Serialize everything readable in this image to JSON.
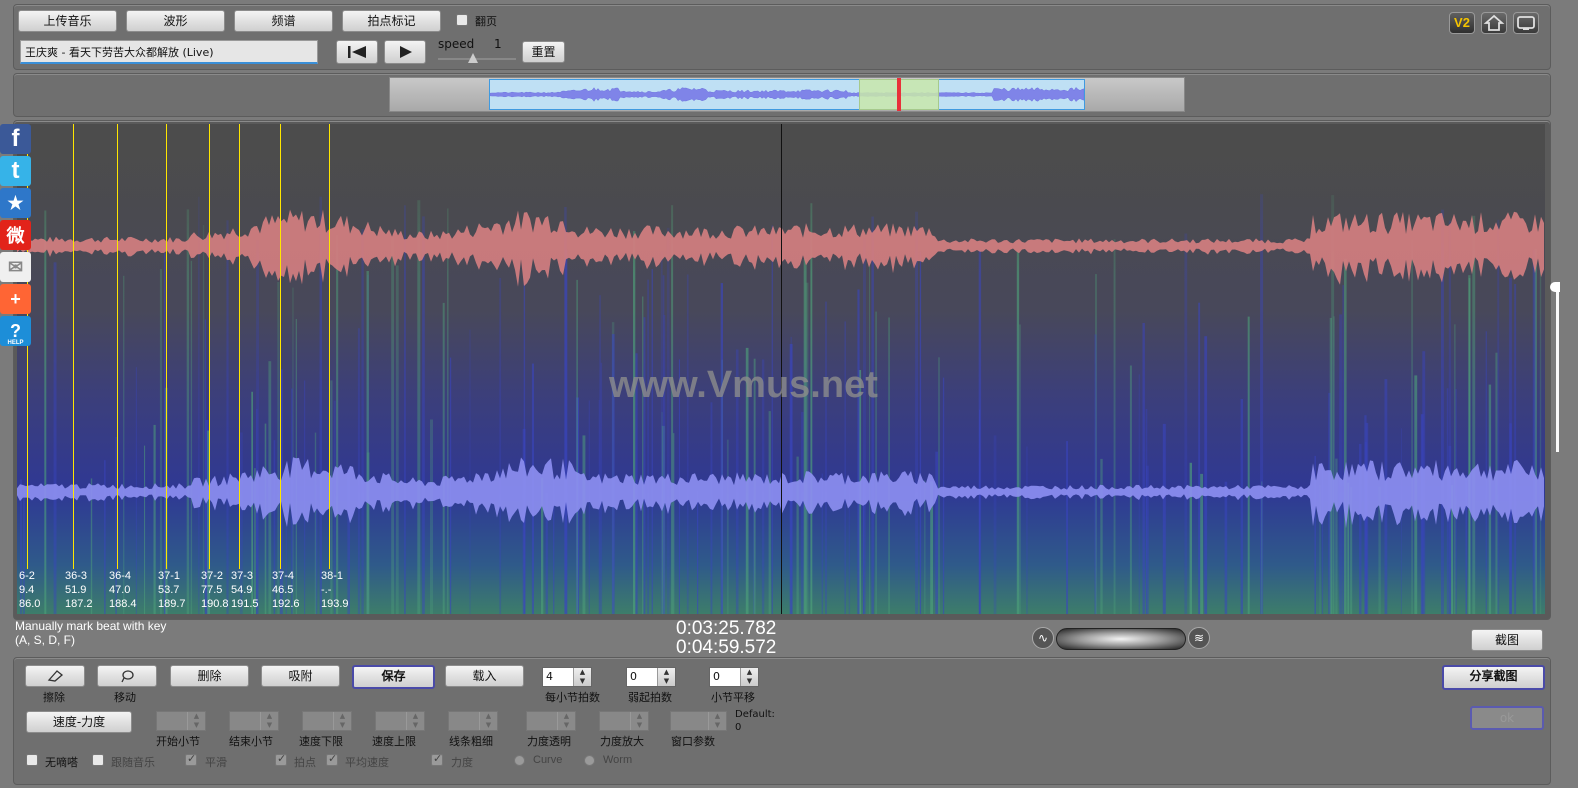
{
  "toolbar": {
    "upload_label": "上传音乐",
    "waveform_label": "波形",
    "spectrum_label": "频谱",
    "beat_mark_label": "拍点标记",
    "page_turn_label": "翻页",
    "song_title": "王庆爽 - 看天下劳苦大众都解放 (Live)",
    "speed_label": "speed",
    "speed_value": "1",
    "reset_label": "重置",
    "speed_slider_level": 0.45
  },
  "top_right": {
    "v2_label": "V2",
    "icons": [
      "home-icon",
      "monitor-icon"
    ]
  },
  "social": [
    {
      "name": "facebook-icon",
      "glyph": "f",
      "color": "#3b5998"
    },
    {
      "name": "twitter-icon",
      "glyph": "t",
      "color": "#36b3e8"
    },
    {
      "name": "favorite-star-icon",
      "glyph": "★",
      "color": "#2e77c9"
    },
    {
      "name": "weibo-icon",
      "glyph": "微",
      "color": "#e2231a"
    },
    {
      "name": "email-icon",
      "glyph": "✉",
      "color": "#f0f0f0"
    },
    {
      "name": "share-plus-icon",
      "glyph": "+",
      "color": "#ff6534"
    },
    {
      "name": "help-icon",
      "glyph": "?",
      "color": "#1d8ed8"
    }
  ],
  "help_label": "HELP",
  "watermark": "www.Vmus.net",
  "beat_markers": [
    {
      "label": "6-2",
      "bpm": "9.4",
      "time": "86.0"
    },
    {
      "label": "36-3",
      "bpm": "51.9",
      "time": "187.2"
    },
    {
      "label": "36-4",
      "bpm": "47.0",
      "time": "188.4"
    },
    {
      "label": "37-1",
      "bpm": "53.7",
      "time": "189.7"
    },
    {
      "label": "37-2",
      "bpm": "77.5",
      "time": "190.8"
    },
    {
      "label": "37-3",
      "bpm": "54.9",
      "time": "191.5"
    },
    {
      "label": "37-4",
      "bpm": "46.5",
      "time": "192.6"
    },
    {
      "label": "38-1",
      "bpm": "-.-",
      "time": "193.9"
    }
  ],
  "status": {
    "hint_line1": "Manually mark beat with key",
    "hint_line2": "(A, S, D, F)",
    "current_time": "0:03:25.782",
    "total_time": "0:04:59.572",
    "screenshot_label": "截图"
  },
  "editor": {
    "erase_label": "擦除",
    "move_label": "移动",
    "delete_label": "删除",
    "snap_label": "吸附",
    "save_label": "保存",
    "load_label": "载入",
    "beats_per_bar_value": "4",
    "beats_per_bar_label": "每小节拍数",
    "weak_beats_value": "0",
    "weak_beats_label": "弱起拍数",
    "bar_offset_value": "0",
    "bar_offset_label": "小节平移",
    "share_shot_label": "分享截图",
    "ok_label": "ok",
    "speed_force_label": "速度-力度",
    "start_bar_label": "开始小节",
    "end_bar_label": "结束小节",
    "speed_min_label": "速度下限",
    "speed_max_label": "速度上限",
    "line_width_label": "线条粗细",
    "force_alpha_label": "力度透明",
    "force_scale_label": "力度放大",
    "window_param_label": "窗口参数",
    "default_label": "Default:",
    "default_value": "0",
    "no_beep_label": "无嘀嗒",
    "follow_music_label": "跟随音乐",
    "smooth_label": "平滑",
    "beat_point_label": "拍点",
    "avg_speed_label": "平均速度",
    "force_label": "力度",
    "curve_label": "Curve",
    "worm_label": "Worm"
  }
}
